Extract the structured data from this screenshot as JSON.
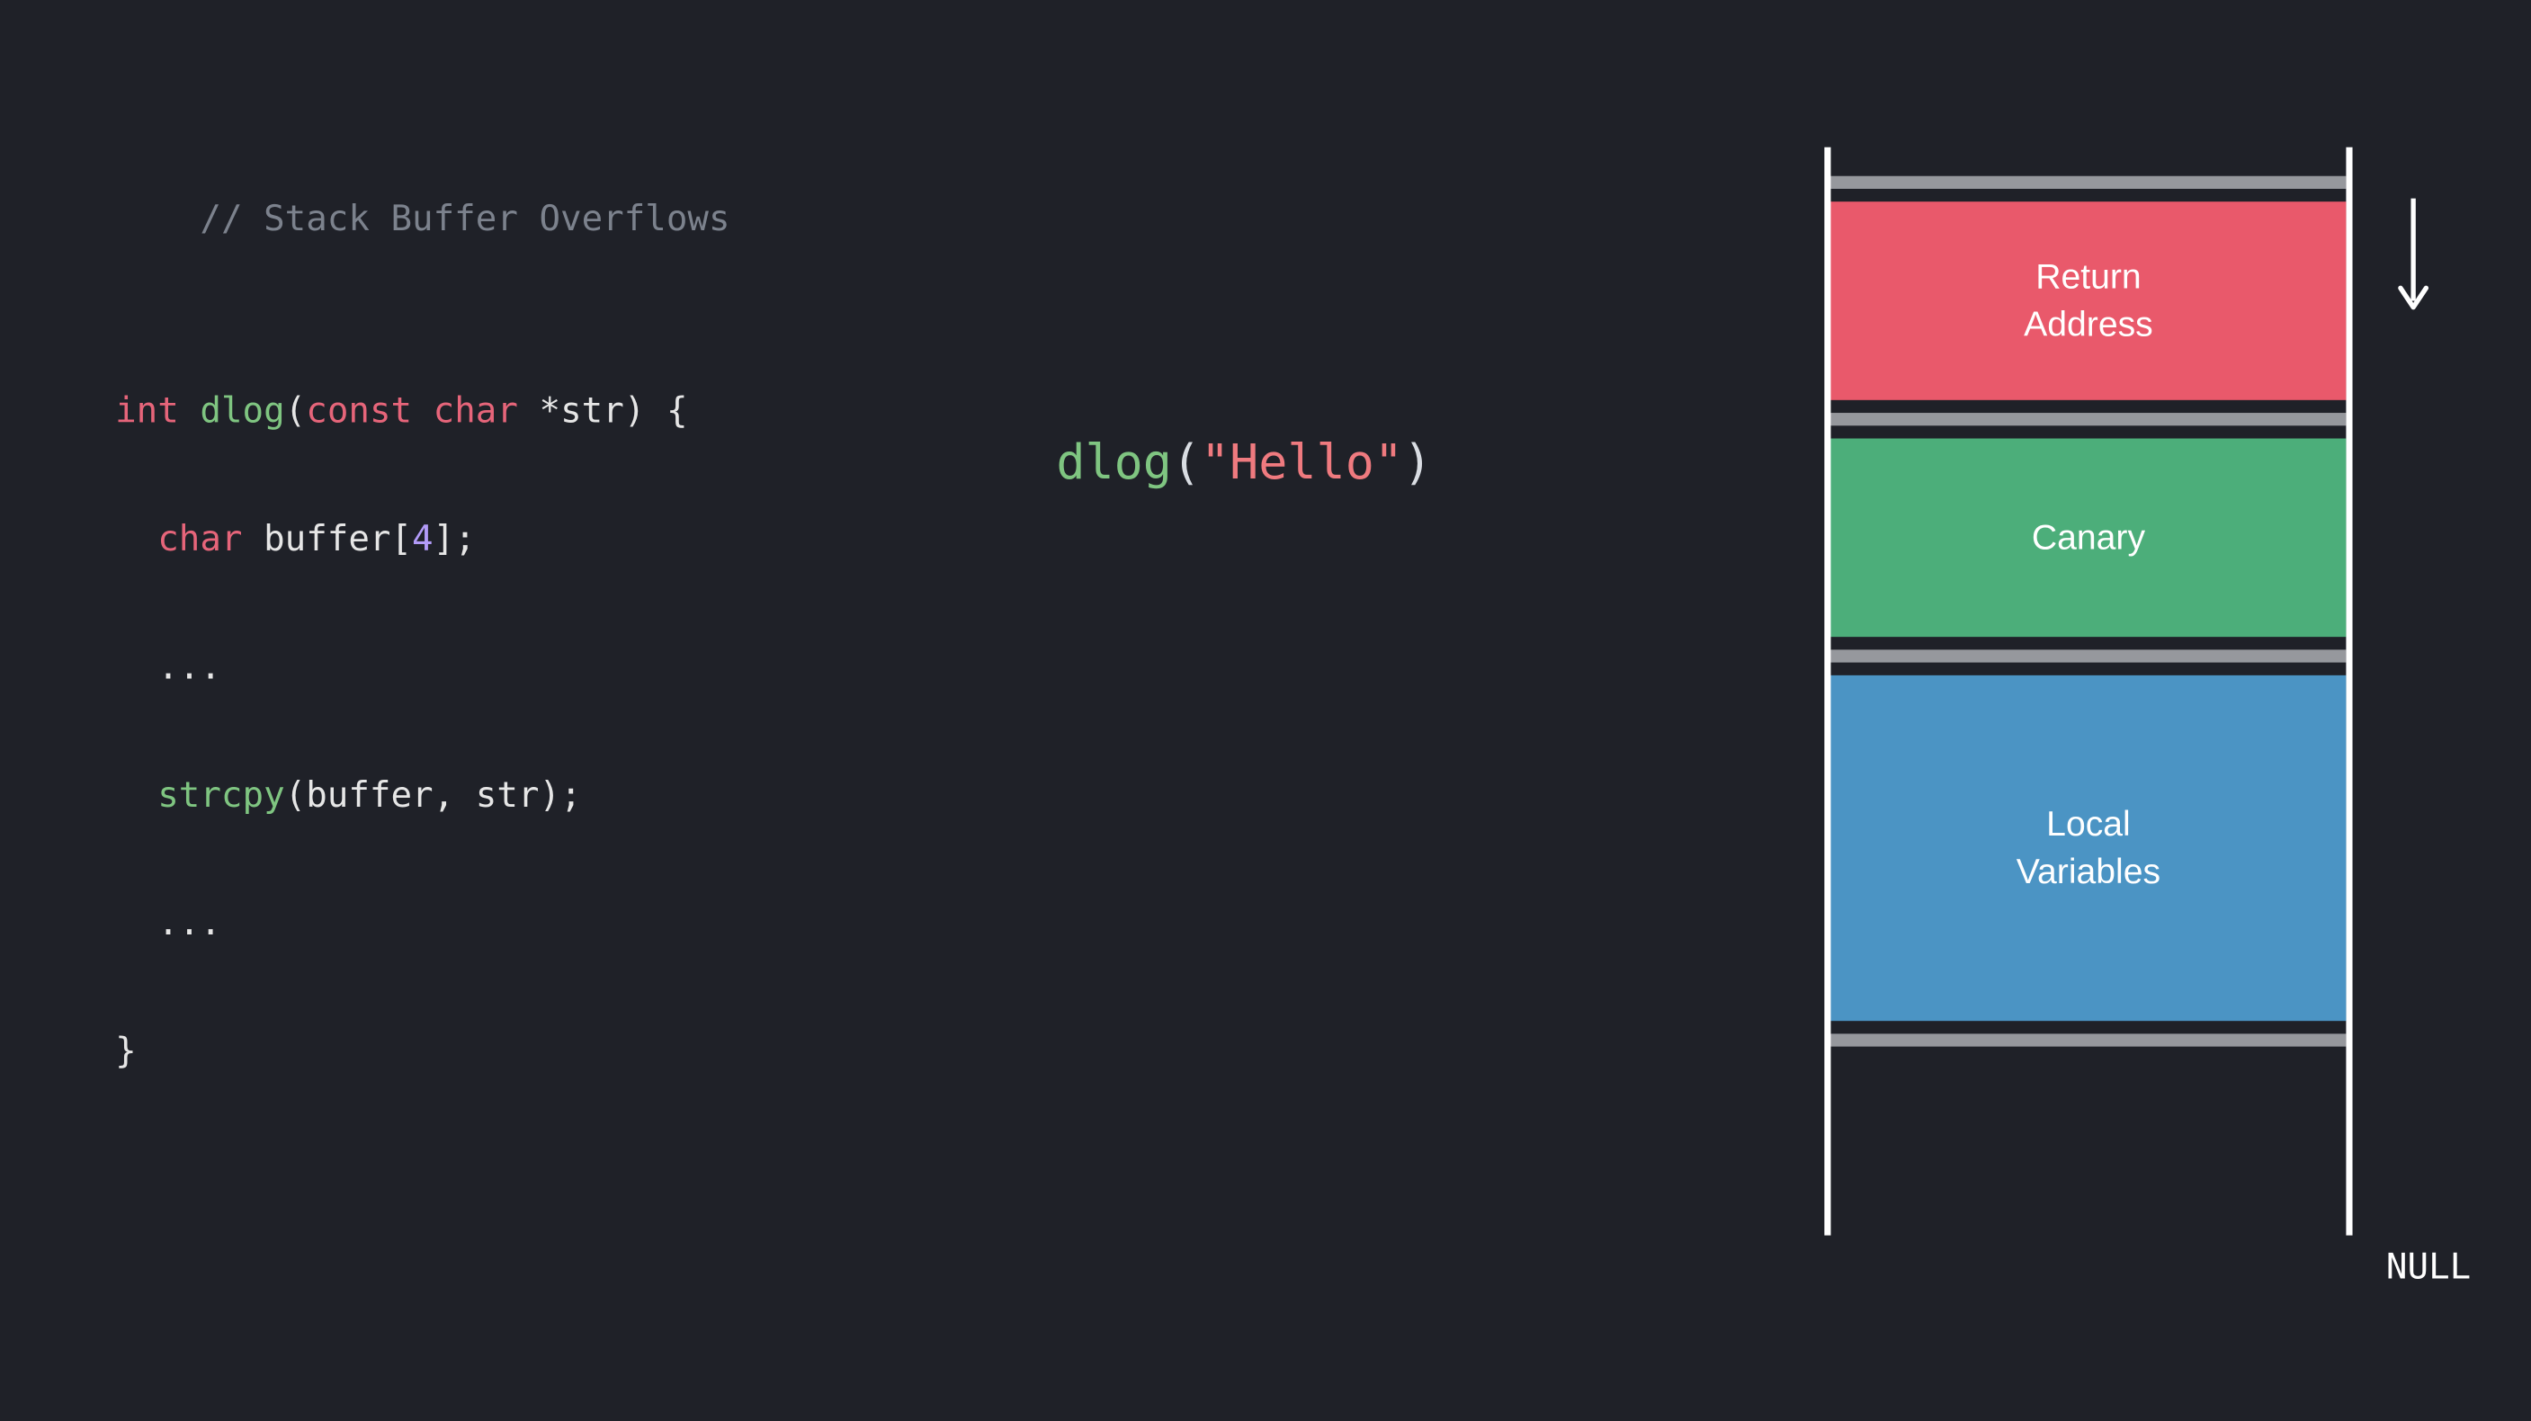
{
  "code": {
    "comment": "// Stack Buffer Overflows",
    "l1_kw1": "int",
    "l1_fn": "dlog",
    "l1_paren_open": "(",
    "l1_kw2": "const char",
    "l1_star": " *",
    "l1_param": "str",
    "l1_close": ") {",
    "l2_kw": "char",
    "l2_id": " buffer",
    "l2_br_open": "[",
    "l2_num": "4",
    "l2_br_close": "];",
    "l3": "...",
    "l4_fn": "strcpy",
    "l4_args": "(buffer, str);",
    "l5": "...",
    "l6": "}"
  },
  "call": {
    "fn": "dlog",
    "open": "(",
    "str": "\"Hello\"",
    "close": ")"
  },
  "stack": {
    "frames": [
      {
        "key": "return",
        "line1": "Return",
        "line2": "Address",
        "color": "#e9596b"
      },
      {
        "key": "canary",
        "line1": "Canary",
        "line2": "",
        "color": "#4cae7a"
      },
      {
        "key": "locals",
        "line1": "Local",
        "line2": "Variables",
        "color": "#4b94c4"
      }
    ],
    "null_label": "NULL"
  }
}
